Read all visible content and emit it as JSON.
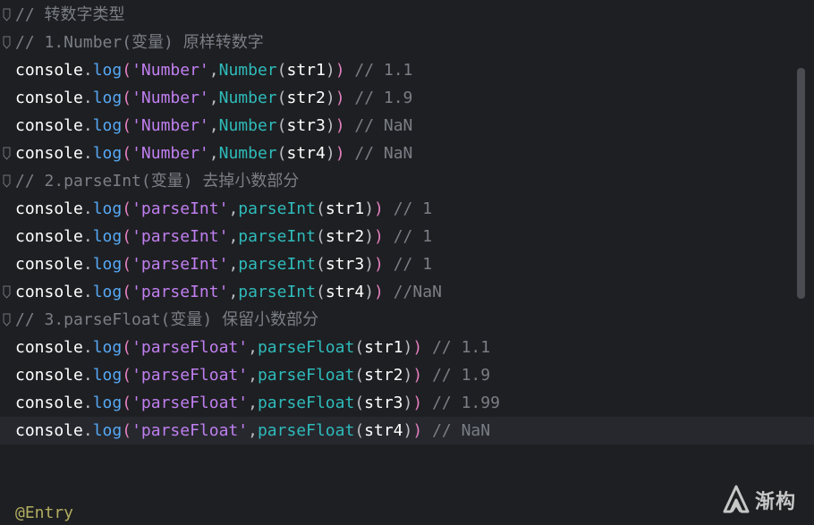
{
  "editor": {
    "lines": [
      {
        "kind": "comment",
        "fold": true,
        "text": "// 转数字类型"
      },
      {
        "kind": "comment",
        "fold": true,
        "text": "// 1.Number(变量) 原样转数字"
      },
      {
        "kind": "code",
        "obj": "console",
        "fn": "log",
        "str": "'Number'",
        "call": "Number",
        "arg": "str1",
        "comment": "// 1.1"
      },
      {
        "kind": "code",
        "obj": "console",
        "fn": "log",
        "str": "'Number'",
        "call": "Number",
        "arg": "str2",
        "comment": "// 1.9"
      },
      {
        "kind": "code",
        "obj": "console",
        "fn": "log",
        "str": "'Number'",
        "call": "Number",
        "arg": "str3",
        "comment": "// NaN"
      },
      {
        "kind": "code",
        "obj": "console",
        "fn": "log",
        "str": "'Number'",
        "call": "Number",
        "arg": "str4",
        "comment": "// NaN",
        "fold": true
      },
      {
        "kind": "comment",
        "fold": true,
        "text": "// 2.parseInt(变量) 去掉小数部分"
      },
      {
        "kind": "code",
        "obj": "console",
        "fn": "log",
        "str": "'parseInt'",
        "call": "parseInt",
        "arg": "str1",
        "comment": "// 1"
      },
      {
        "kind": "code",
        "obj": "console",
        "fn": "log",
        "str": "'parseInt'",
        "call": "parseInt",
        "arg": "str2",
        "comment": "// 1"
      },
      {
        "kind": "code",
        "obj": "console",
        "fn": "log",
        "str": "'parseInt'",
        "call": "parseInt",
        "arg": "str3",
        "comment": "// 1"
      },
      {
        "kind": "code",
        "obj": "console",
        "fn": "log",
        "str": "'parseInt'",
        "call": "parseInt",
        "arg": "str4",
        "comment": "//NaN",
        "fold": true
      },
      {
        "kind": "comment",
        "fold": true,
        "text": "// 3.parseFloat(变量) 保留小数部分"
      },
      {
        "kind": "code",
        "obj": "console",
        "fn": "log",
        "str": "'parseFloat'",
        "call": "parseFloat",
        "arg": "str1",
        "comment": "// 1.1"
      },
      {
        "kind": "code",
        "obj": "console",
        "fn": "log",
        "str": "'parseFloat'",
        "call": "parseFloat",
        "arg": "str2",
        "comment": "// 1.9"
      },
      {
        "kind": "code",
        "obj": "console",
        "fn": "log",
        "str": "'parseFloat'",
        "call": "parseFloat",
        "arg": "str3",
        "comment": "// 1.99"
      },
      {
        "kind": "code",
        "obj": "console",
        "fn": "log",
        "str": "'parseFloat'",
        "call": "parseFloat",
        "arg": "str4",
        "comment": "// NaN",
        "current": true
      }
    ],
    "decorator": "@Entry"
  },
  "watermark": {
    "text": "渐构",
    "icon": "jiangou-logo-icon"
  },
  "colors": {
    "background": "#1e1f22",
    "current_line": "#26282e",
    "comment": "#7a7e85",
    "identifier": "#ffffff",
    "method": "#56a8f5",
    "string": "#c07ff0",
    "call": "#2fbbbb",
    "paren": "#e580c1",
    "decorator": "#b3ae60"
  }
}
